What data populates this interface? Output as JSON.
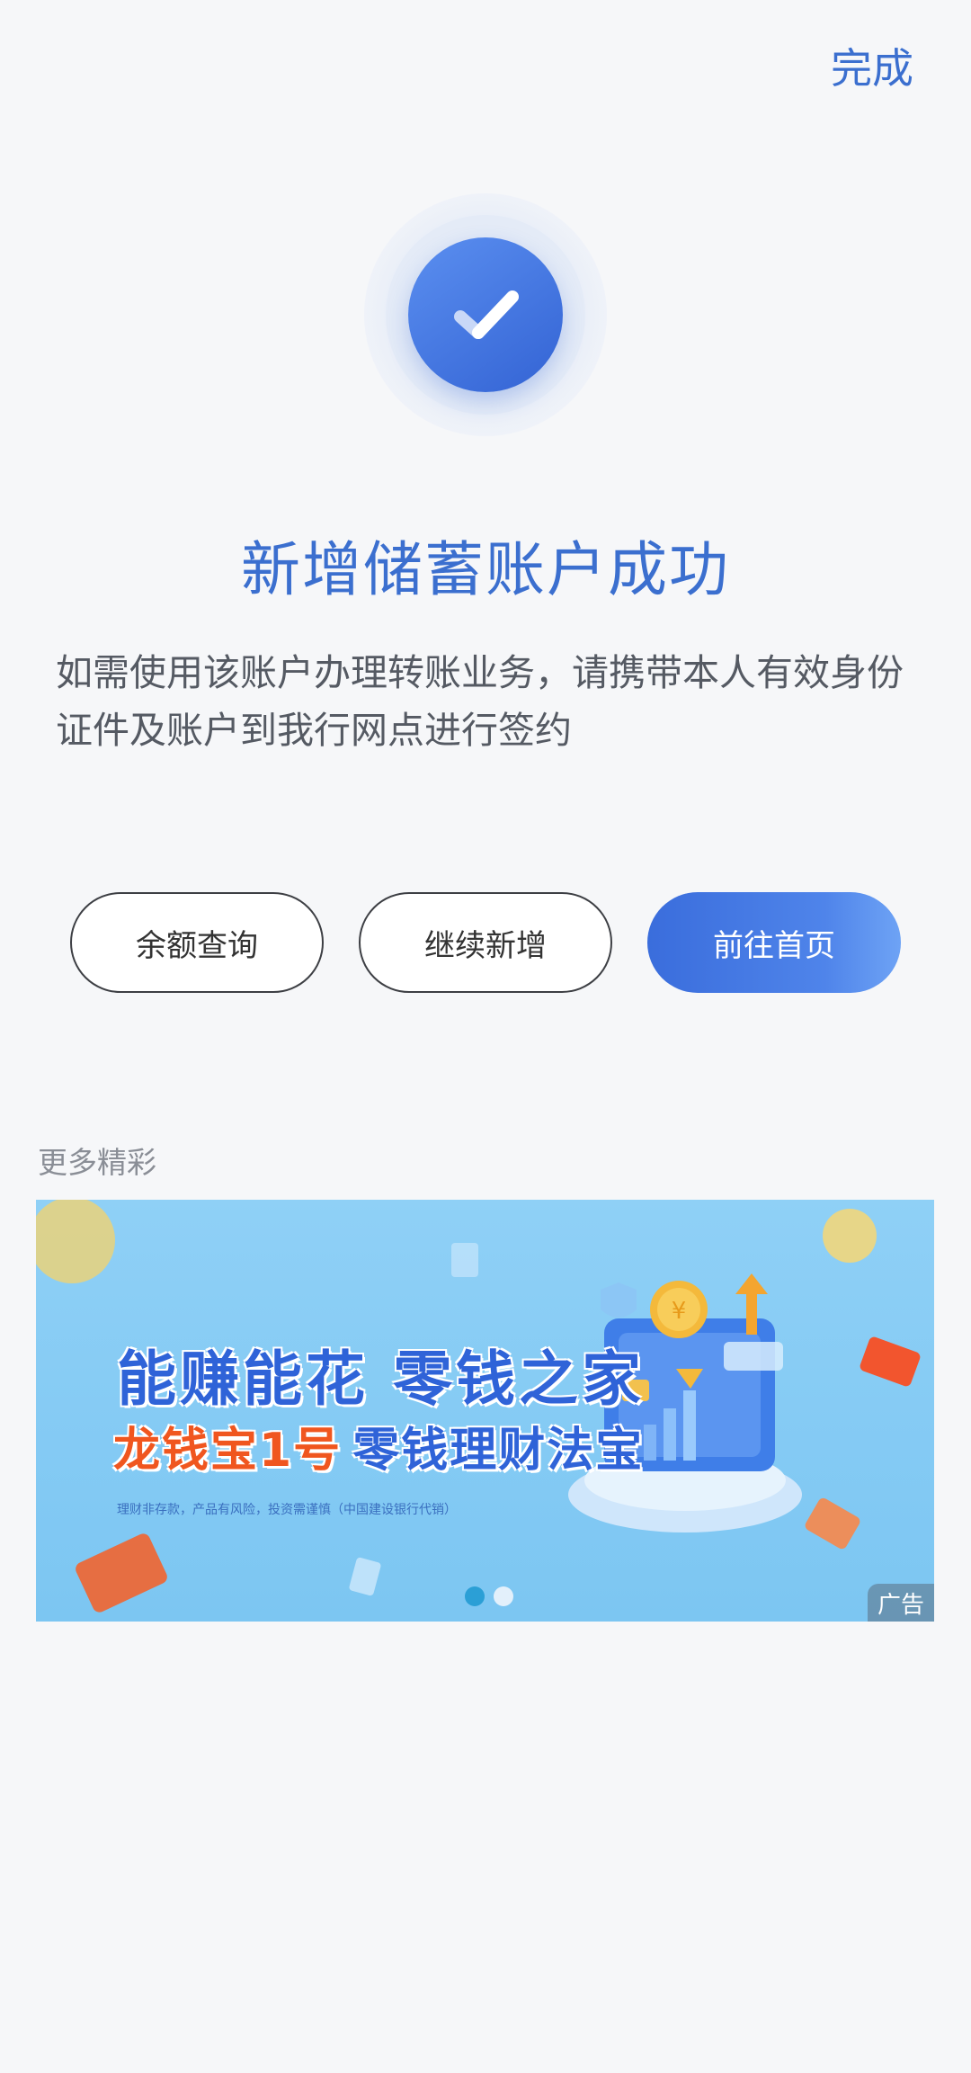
{
  "header": {
    "done_label": "完成"
  },
  "result": {
    "icon": "check-icon",
    "title": "新增储蓄账户成功",
    "description": "如需使用该账户办理转账业务，请携带本人有效身份证件及账户到我行网点进行签约"
  },
  "actions": {
    "balance_label": "余额查询",
    "continue_label": "继续新增",
    "home_label": "前往首页"
  },
  "more": {
    "section_label": "更多精彩",
    "banner": {
      "line1": "能赚能花 零钱之家",
      "line2_part1": "龙钱宝1号",
      "line2_part2": "零钱理财法宝",
      "note": "理财非存款，产品有风险，投资需谨慎（中国建设银行代销）",
      "ad_label": "广告",
      "page_count": 2,
      "active_page": 1
    }
  },
  "colors": {
    "accent": "#3b6fcf",
    "primary_button": "#3a6ddc",
    "background": "#f6f7f9"
  }
}
